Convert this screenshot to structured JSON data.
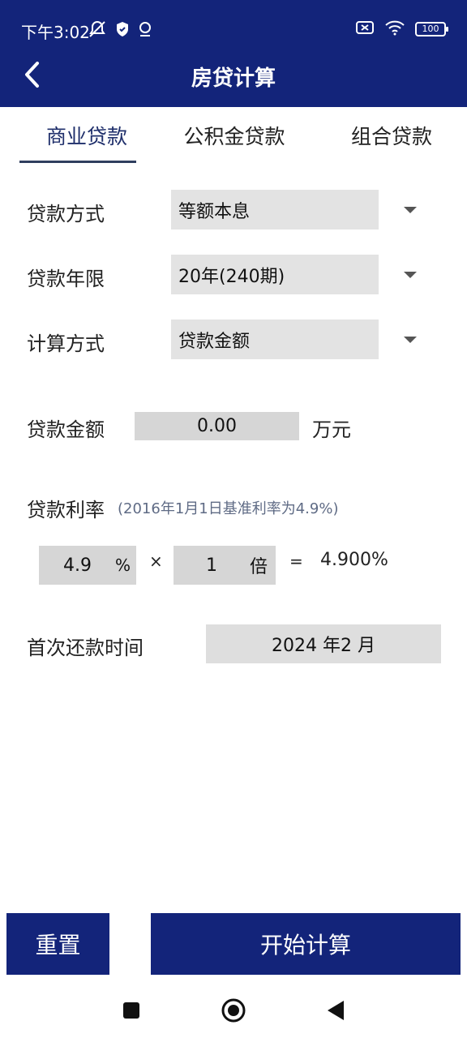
{
  "status_bar": {
    "time": "下午3:02",
    "battery": "100",
    "icons": [
      "mute-icon",
      "shield-icon",
      "location-icon",
      "sim-icon",
      "wifi-icon",
      "battery-icon"
    ]
  },
  "header": {
    "title": "房贷计算",
    "back_icon": "chevron-left-icon",
    "bg_color": "#13247a"
  },
  "tabs": [
    {
      "label": "商业贷款",
      "active": true
    },
    {
      "label": "公积金贷款",
      "active": false
    },
    {
      "label": "组合贷款",
      "active": false
    }
  ],
  "form": {
    "loan_method": {
      "label": "贷款方式",
      "value": "等额本息"
    },
    "loan_term": {
      "label": "贷款年限",
      "value": "20年(240期)"
    },
    "calc_method": {
      "label": "计算方式",
      "value": "贷款金额"
    },
    "loan_amount": {
      "label": "贷款金额",
      "value": "0.00",
      "unit": "万元"
    },
    "rate": {
      "label": "贷款利率",
      "hint": "(2016年1月1日基准利率为4.9%)",
      "base": "4.9",
      "base_unit": "%",
      "times_symbol": "×",
      "multiplier": "1",
      "multiplier_unit": "倍",
      "equals_symbol": "=",
      "result": "4.900%"
    },
    "first_payment": {
      "label": "首次还款时间",
      "value": "2024 年2 月"
    }
  },
  "actions": {
    "reset": "重置",
    "calculate": "开始计算"
  }
}
